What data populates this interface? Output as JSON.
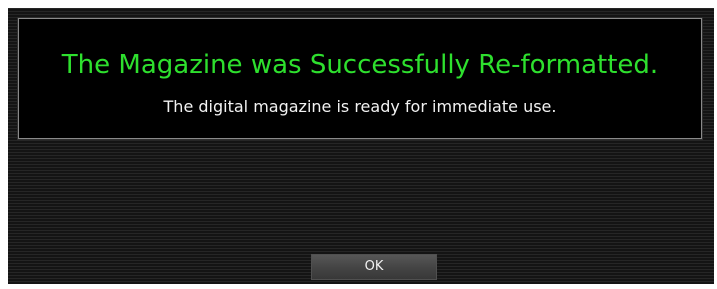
{
  "dialog": {
    "title": "The Magazine was Successfully Re-formatted.",
    "message": "The digital magazine is ready for immediate use.",
    "ok_label": "OK"
  },
  "colors": {
    "title_text": "#2ee02e",
    "message_text": "#f2f2f2",
    "panel_background": "#000000",
    "dialog_background": "#1c1c1c",
    "button_background": "#454545"
  }
}
